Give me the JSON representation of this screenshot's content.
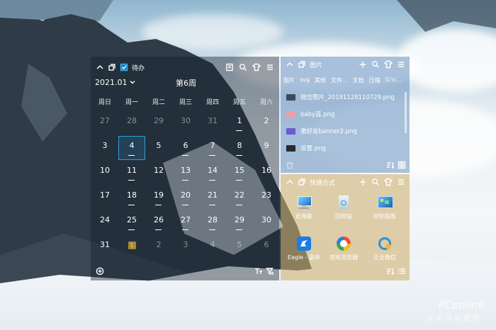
{
  "calendar": {
    "title": "待办",
    "month": "2021.01",
    "week": "第6周",
    "weekdays": [
      "周日",
      "周一",
      "周二",
      "周三",
      "周四",
      "周五",
      "周六"
    ],
    "weeks": [
      [
        {
          "d": "27",
          "dim": true
        },
        {
          "d": "28",
          "dim": true
        },
        {
          "d": "29",
          "dim": true
        },
        {
          "d": "30",
          "dim": true
        },
        {
          "d": "31",
          "dim": true
        },
        {
          "d": "1",
          "mark": true
        },
        {
          "d": "2"
        }
      ],
      [
        {
          "d": "3"
        },
        {
          "d": "4",
          "mark": true,
          "sel": true
        },
        {
          "d": "5"
        },
        {
          "d": "6",
          "mark": true
        },
        {
          "d": "7",
          "mark": true
        },
        {
          "d": "8",
          "mark": true
        },
        {
          "d": "9"
        }
      ],
      [
        {
          "d": "10"
        },
        {
          "d": "11",
          "mark": true
        },
        {
          "d": "12"
        },
        {
          "d": "13",
          "mark": true
        },
        {
          "d": "14",
          "mark": true
        },
        {
          "d": "15",
          "mark": true
        },
        {
          "d": "16"
        }
      ],
      [
        {
          "d": "17"
        },
        {
          "d": "18",
          "mark": true
        },
        {
          "d": "19",
          "mark": true
        },
        {
          "d": "20",
          "mark": true
        },
        {
          "d": "21",
          "mark": true
        },
        {
          "d": "22",
          "mark": true
        },
        {
          "d": "23"
        }
      ],
      [
        {
          "d": "24"
        },
        {
          "d": "25",
          "mark": true
        },
        {
          "d": "26",
          "mark": true
        },
        {
          "d": "27",
          "mark": true
        },
        {
          "d": "28",
          "mark": true
        },
        {
          "d": "29",
          "mark": true
        },
        {
          "d": "30"
        }
      ],
      [
        {
          "d": "31"
        },
        {
          "d": "1",
          "badge": true
        },
        {
          "d": "2",
          "dim": true
        },
        {
          "d": "3",
          "dim": true
        },
        {
          "d": "4",
          "dim": true
        },
        {
          "d": "5",
          "dim": true
        },
        {
          "d": "6",
          "dim": true
        }
      ]
    ]
  },
  "pictures": {
    "title": "图片",
    "tabs": [
      "图片",
      "svg",
      "其他",
      "文件...",
      "文档",
      "压缩",
      "G:\\c..."
    ],
    "files": [
      {
        "name": "微信图片_20191128110729.png",
        "color": "#3a4a5a"
      },
      {
        "name": "baby蓝.png",
        "color": "#e9a0a8"
      },
      {
        "name": "邀好友banner2.png",
        "color": "#6a5ad0"
      },
      {
        "name": "设置.png",
        "color": "#2a2a2a"
      }
    ]
  },
  "shortcuts": {
    "title": "快捷方式",
    "items": [
      {
        "label": "此电脑",
        "icon": "computer-icon"
      },
      {
        "label": "回收站",
        "icon": "recycle-bin-icon"
      },
      {
        "label": "控制面板",
        "icon": "control-panel-icon"
      },
      {
        "label": "Eagle - 副本",
        "icon": "eagle-app-icon"
      },
      {
        "label": "双核浏览器",
        "icon": "browser-icon"
      },
      {
        "label": "企业微信",
        "icon": "wecom-icon"
      }
    ]
  },
  "watermark": {
    "brand": "PConline",
    "sub": "太平洋电脑网"
  },
  "colors": {
    "accent": "#2d9fd6",
    "badge": "#a68833"
  }
}
